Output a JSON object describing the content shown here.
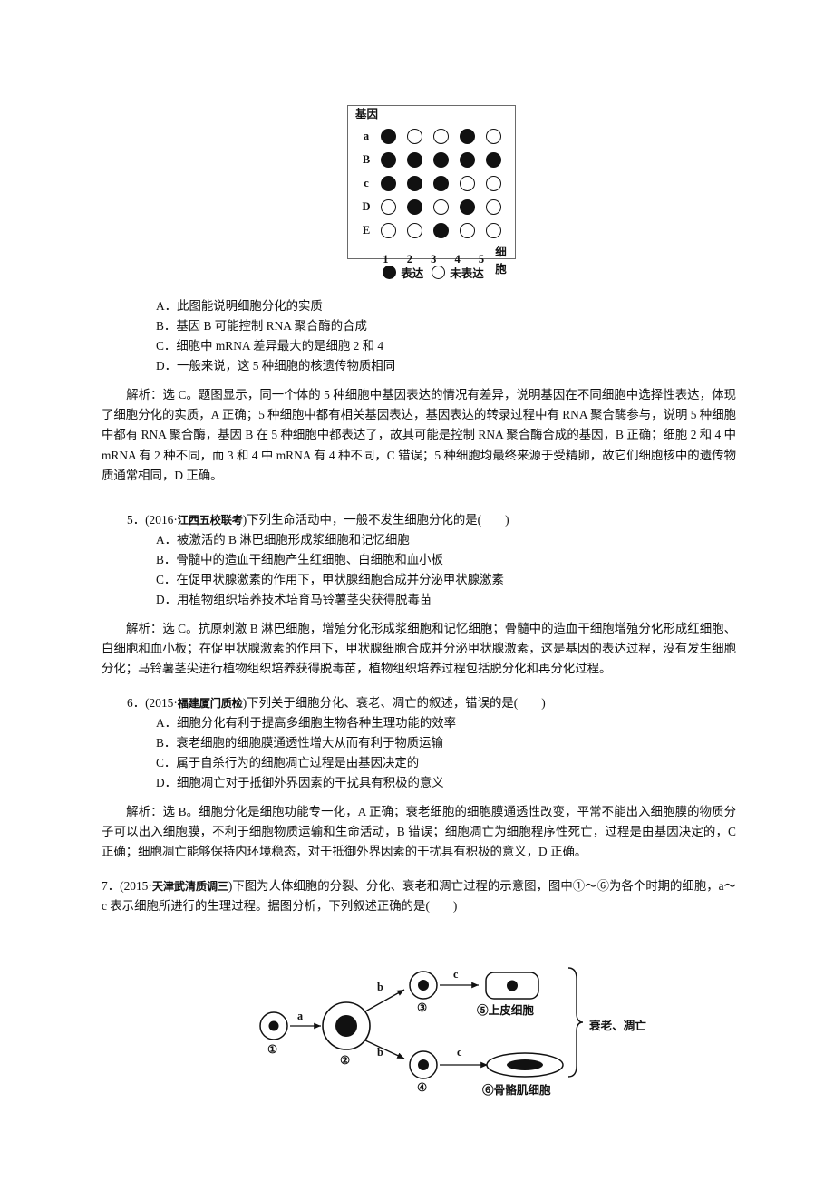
{
  "figure1": {
    "title": "基因",
    "axis_label": "细胞",
    "row_labels": [
      "a",
      "B",
      "c",
      "D",
      "E"
    ],
    "col_labels": [
      "1",
      "2",
      "3",
      "4",
      "5"
    ],
    "matrix": [
      [
        1,
        0,
        0,
        1,
        0
      ],
      [
        1,
        1,
        1,
        1,
        1
      ],
      [
        1,
        1,
        1,
        0,
        0
      ],
      [
        0,
        1,
        0,
        1,
        0
      ],
      [
        0,
        0,
        1,
        0,
        0
      ]
    ],
    "legend": {
      "expressed": "表达",
      "not_expressed": "未表达"
    }
  },
  "q4_options": [
    "A．此图能说明细胞分化的实质",
    "B．基因 B 可能控制 RNA 聚合酶的合成",
    "C．细胞中 mRNA 差异最大的是细胞 2 和 4",
    "D．一般来说，这 5 种细胞的核遗传物质相同"
  ],
  "q4_analysis": "解析：选 C。题图显示，同一个体的 5 种细胞中基因表达的情况有差异，说明基因在不同细胞中选择性表达，体现了细胞分化的实质，A 正确；5 种细胞中都有相关基因表达，基因表达的转录过程中有 RNA 聚合酶参与，说明 5 种细胞中都有 RNA 聚合酶，基因 B 在 5 种细胞中都表达了，故其可能是控制 RNA 聚合酶合成的基因，B 正确；细胞 2 和 4 中 mRNA 有 2 种不同，而 3 和 4 中 mRNA 有 4 种不同，C 错误；5 种细胞均最终来源于受精卵，故它们细胞核中的遗传物质通常相同，D 正确。",
  "q5": {
    "number": "5．",
    "source": "(2016·江西五校联考)",
    "source_prefix": "(2016·",
    "source_bold": "江西五校联考",
    "source_suffix": ")",
    "stem": "下列生命活动中，一般不发生细胞分化的是(",
    "stem_end": ")",
    "options": [
      "A．被激活的 B 淋巴细胞形成浆细胞和记忆细胞",
      "B．骨髓中的造血干细胞产生红细胞、白细胞和血小板",
      "C．在促甲状腺激素的作用下，甲状腺细胞合成并分泌甲状腺激素",
      "D．用植物组织培养技术培育马铃薯茎尖获得脱毒苗"
    ],
    "analysis": "解析：选 C。抗原刺激 B 淋巴细胞，增殖分化形成浆细胞和记忆细胞；骨髓中的造血干细胞增殖分化形成红细胞、白细胞和血小板；在促甲状腺激素的作用下，甲状腺细胞合成并分泌甲状腺激素，这是基因的表达过程，没有发生细胞分化；马铃薯茎尖进行植物组织培养获得脱毒苗，植物组织培养过程包括脱分化和再分化过程。"
  },
  "q6": {
    "number": "6．",
    "source_prefix": "(2015·",
    "source_bold": "福建厦门质检",
    "source_suffix": ")",
    "stem": "下列关于细胞分化、衰老、凋亡的叙述，错误的是(",
    "stem_end": ")",
    "options": [
      "A．细胞分化有利于提高多细胞生物各种生理功能的效率",
      "B．衰老细胞的细胞膜通透性增大从而有利于物质运输",
      "C．属于自杀行为的细胞凋亡过程是由基因决定的",
      "D．细胞凋亡对于抵御外界因素的干扰具有积极的意义"
    ],
    "analysis": "解析：选 B。细胞分化是细胞功能专一化，A 正确；衰老细胞的细胞膜通透性改变，平常不能出入细胞膜的物质分子可以出入细胞膜，不利于细胞物质运输和生命活动，B 错误；细胞凋亡为细胞程序性死亡，过程是由基因决定的，C 正确；细胞凋亡能够保持内环境稳态，对于抵御外界因素的干扰具有积极的意义，D 正确。"
  },
  "q7": {
    "number": "7．",
    "source_prefix": "(2015·",
    "source_bold": "天津武清质调三",
    "source_suffix": ")",
    "stem": "下图为人体细胞的分裂、分化、衰老和凋亡过程的示意图，图中①～⑥为各个时期的细胞，a～c 表示细胞所进行的生理过程。据图分析，下列叙述正确的是(",
    "stem_end": ")"
  },
  "figure2": {
    "process_labels": [
      "a",
      "b",
      "b",
      "c",
      "c"
    ],
    "cell_numbers": [
      "①",
      "②",
      "③",
      "④"
    ],
    "cell5_label": "⑤上皮细胞",
    "cell6_label": "⑥骨骼肌细胞",
    "brace_label": "衰老、凋亡"
  },
  "colors": {
    "ink": "#101010",
    "figure_border": "#6a6a6a",
    "dot_fill": "#111111"
  }
}
